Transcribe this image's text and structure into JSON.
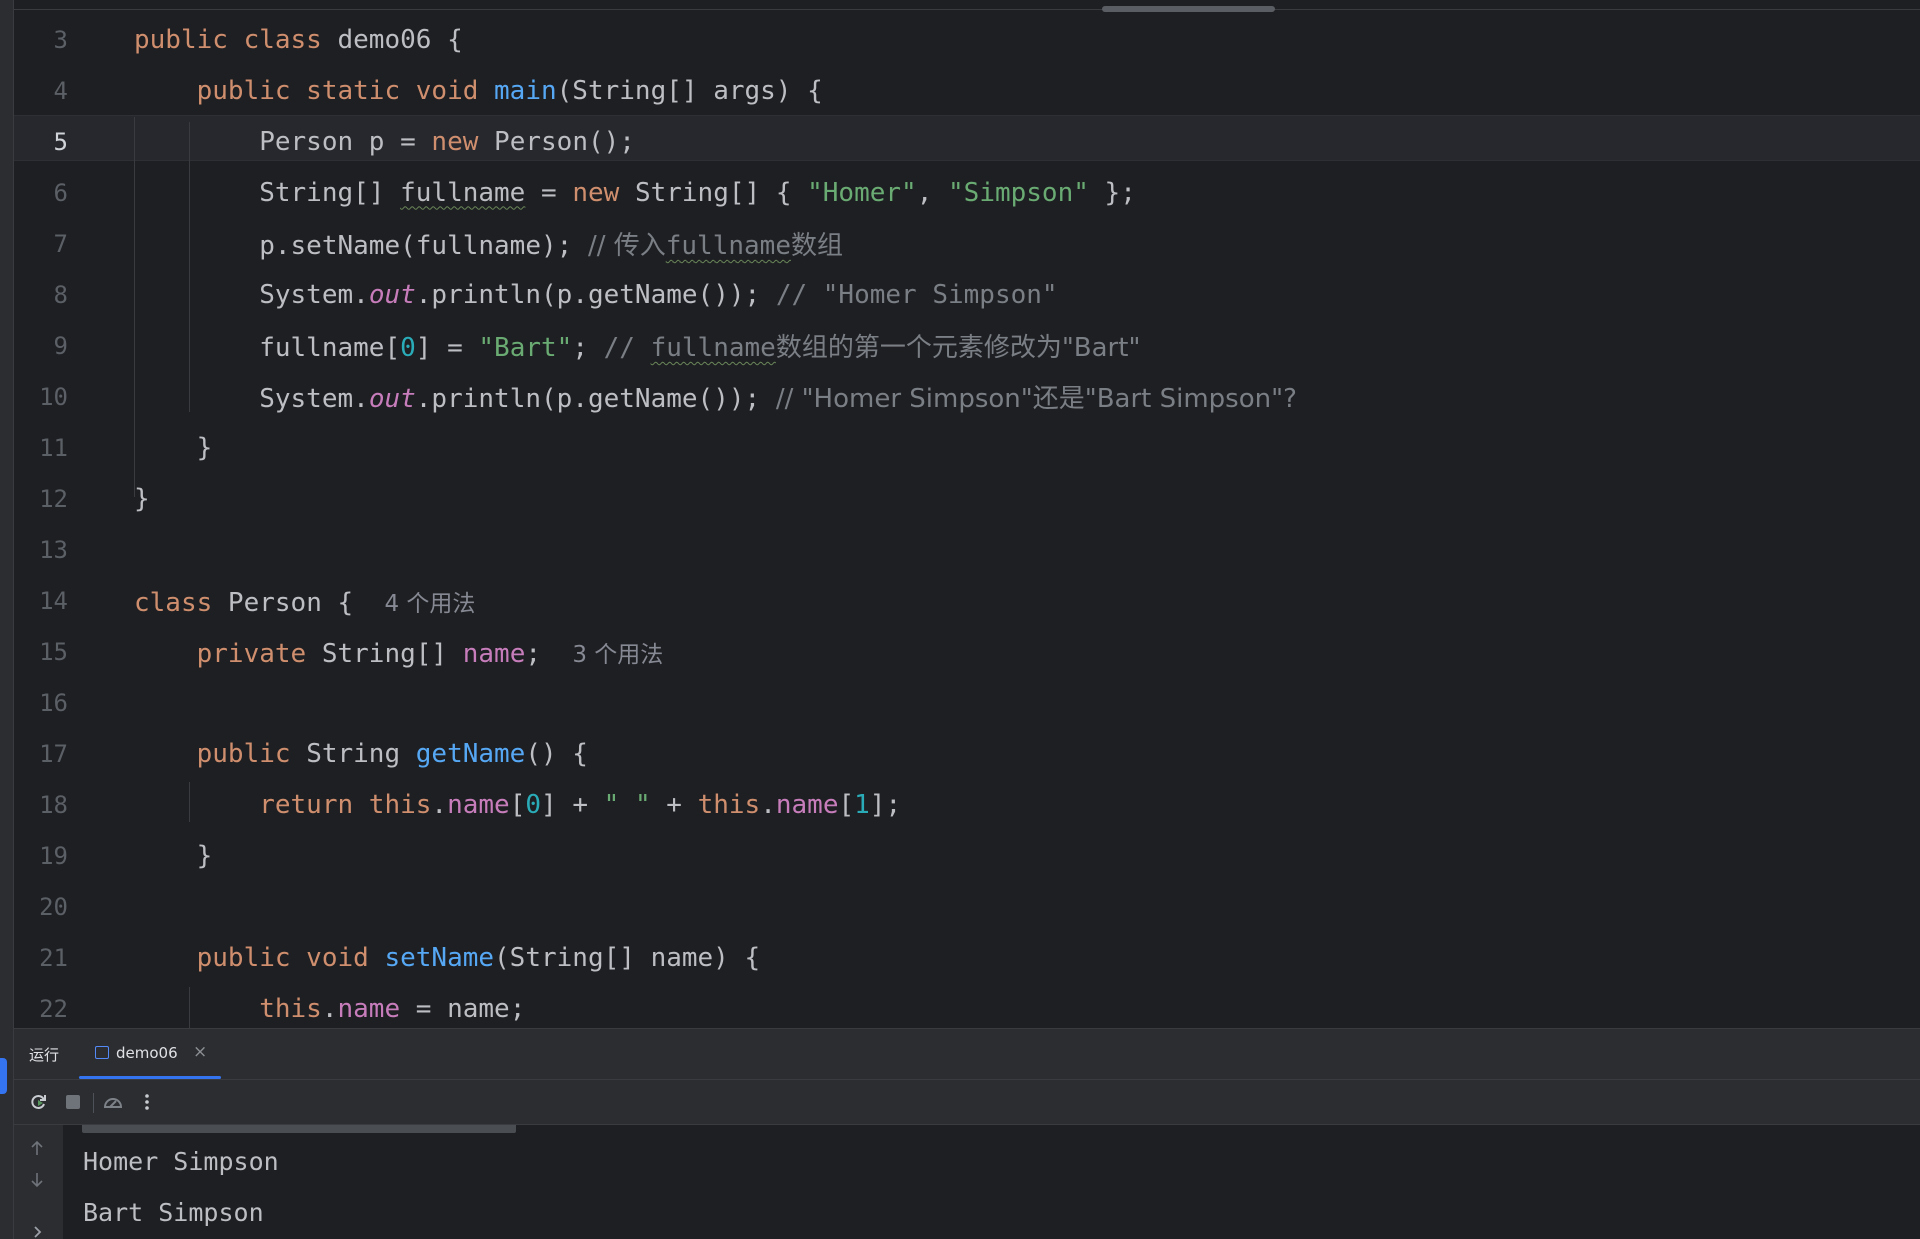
{
  "editor": {
    "current_line": "5",
    "lines": [
      {
        "num": "3",
        "segs": [
          [
            "kw",
            "public class "
          ],
          [
            "",
            "demo06 {"
          ]
        ]
      },
      {
        "num": "4",
        "segs": [
          [
            "kw",
            "    public static void "
          ],
          [
            "fn",
            "main"
          ],
          [
            "",
            "(String[] args) {"
          ]
        ]
      },
      {
        "num": "5",
        "segs": [
          [
            "",
            "        Person p = "
          ],
          [
            "kw",
            "new "
          ],
          [
            "",
            "Person();"
          ]
        ]
      },
      {
        "num": "6",
        "segs": [
          [
            "",
            "        String[] "
          ],
          [
            "ul",
            "fullname"
          ],
          [
            "",
            " = "
          ],
          [
            "kw",
            "new "
          ],
          [
            "",
            "String[] { "
          ],
          [
            "str",
            "\"Homer\""
          ],
          [
            "",
            ", "
          ],
          [
            "str",
            "\"Simpson\""
          ],
          [
            "",
            " };"
          ]
        ]
      },
      {
        "num": "7",
        "segs": [
          [
            "",
            "        p.setName(fullname); "
          ],
          [
            "cmt",
            "// 传入"
          ],
          [
            "cmt ul",
            "fullname"
          ],
          [
            "cmt",
            "数组"
          ]
        ]
      },
      {
        "num": "8",
        "segs": [
          [
            "",
            "        System."
          ],
          [
            "ital",
            "out"
          ],
          [
            "",
            ".println(p.getName()); "
          ],
          [
            "cmt",
            "// \"Homer Simpson\""
          ]
        ]
      },
      {
        "num": "9",
        "segs": [
          [
            "",
            "        fullname["
          ],
          [
            "num",
            "0"
          ],
          [
            "",
            "] = "
          ],
          [
            "str",
            "\"Bart\""
          ],
          [
            "",
            "; "
          ],
          [
            "cmt",
            "// "
          ],
          [
            "cmt ul",
            "fullname"
          ],
          [
            "cmt",
            "数组的第一个元素修改为\"Bart\""
          ]
        ]
      },
      {
        "num": "10",
        "segs": [
          [
            "",
            "        System."
          ],
          [
            "ital",
            "out"
          ],
          [
            "",
            ".println(p.getName()); "
          ],
          [
            "cmt",
            "// \"Homer Simpson\"还是\"Bart Simpson\"?"
          ]
        ]
      },
      {
        "num": "11",
        "segs": [
          [
            "",
            "    }"
          ]
        ]
      },
      {
        "num": "12",
        "segs": [
          [
            "",
            "}"
          ]
        ]
      },
      {
        "num": "13",
        "segs": []
      },
      {
        "num": "14",
        "segs": [
          [
            "kw",
            "class "
          ],
          [
            "",
            "Person {  "
          ],
          [
            "hint",
            "4 个用法"
          ]
        ]
      },
      {
        "num": "15",
        "segs": [
          [
            "kw",
            "    private "
          ],
          [
            "",
            "String[] "
          ],
          [
            "fld",
            "name"
          ],
          [
            "",
            ";  "
          ],
          [
            "hint",
            "3 个用法"
          ]
        ]
      },
      {
        "num": "16",
        "segs": []
      },
      {
        "num": "17",
        "segs": [
          [
            "kw",
            "    public "
          ],
          [
            "",
            "String "
          ],
          [
            "fn",
            "getName"
          ],
          [
            "",
            "() {"
          ]
        ]
      },
      {
        "num": "18",
        "segs": [
          [
            "kw",
            "        return this"
          ],
          [
            "",
            "."
          ],
          [
            "fld",
            "name"
          ],
          [
            "",
            "["
          ],
          [
            "num",
            "0"
          ],
          [
            "",
            "] + "
          ],
          [
            "str",
            "\" \""
          ],
          [
            "",
            " + "
          ],
          [
            "kw",
            "this"
          ],
          [
            "",
            "."
          ],
          [
            "fld",
            "name"
          ],
          [
            "",
            "["
          ],
          [
            "num",
            "1"
          ],
          [
            "",
            "];"
          ]
        ]
      },
      {
        "num": "19",
        "segs": [
          [
            "",
            "    }"
          ]
        ]
      },
      {
        "num": "20",
        "segs": []
      },
      {
        "num": "21",
        "segs": [
          [
            "kw",
            "    public void "
          ],
          [
            "fn",
            "setName"
          ],
          [
            "",
            "(String[] name) {"
          ]
        ]
      },
      {
        "num": "22",
        "segs": [
          [
            "kw",
            "        this"
          ],
          [
            "",
            "."
          ],
          [
            "fld",
            "name"
          ],
          [
            "",
            " = name;"
          ]
        ]
      }
    ]
  },
  "run_panel": {
    "title": "运行",
    "tab_label": "demo06",
    "close_glyph": "×",
    "output": [
      "Homer Simpson",
      "Bart Simpson"
    ]
  },
  "icons": {
    "rerun": "rerun-icon",
    "stop": "stop-icon",
    "restore-layout": "restore-layout-icon",
    "more": "more-options-icon",
    "scroll-up": "arrow-up-icon",
    "scroll-down": "arrow-down-icon",
    "expand": "chevron-right-icon"
  },
  "colors": {
    "background": "#1e1f22",
    "keyword": "#cf8e6d",
    "function": "#56a8f5",
    "string": "#6aab73",
    "number": "#2aacb8",
    "field": "#c77dbb",
    "comment": "#7a7e85",
    "accent": "#3574f0"
  }
}
